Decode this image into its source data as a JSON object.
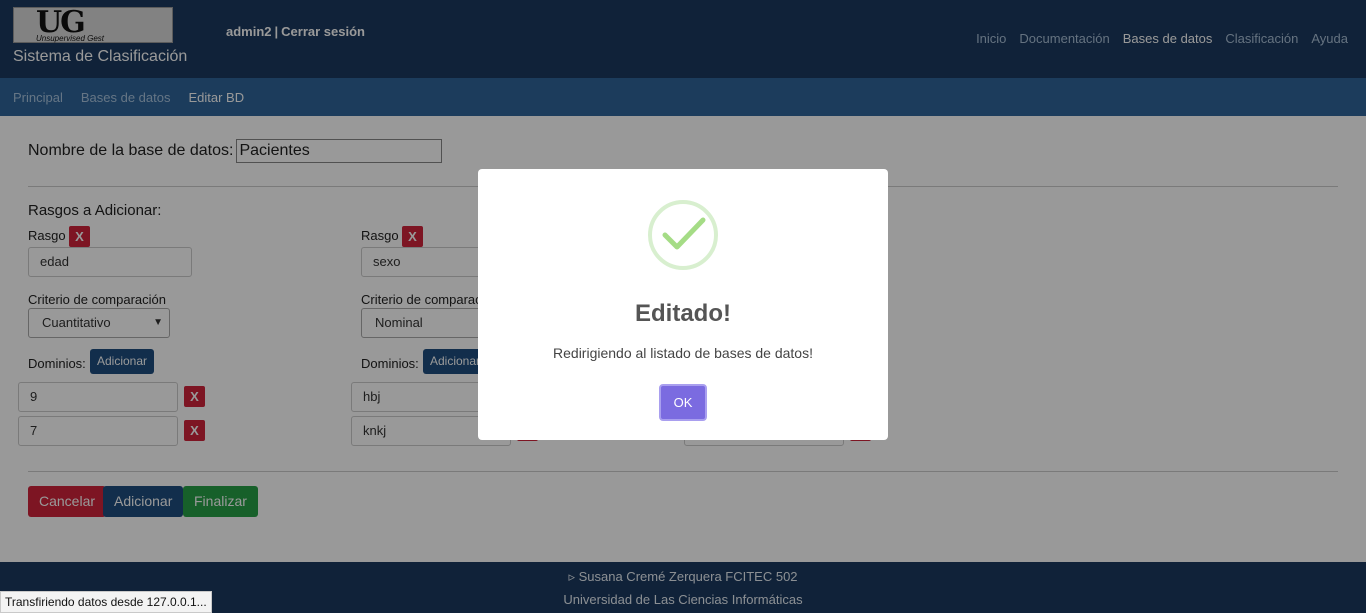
{
  "header": {
    "logo_text": "UG",
    "logo_subtext": "Unsupervised Gest",
    "app_title": "Sistema de Clasificación",
    "user": "admin2",
    "logout": "Cerrar sesión",
    "nav": [
      "Inicio",
      "Documentación",
      "Bases de datos",
      "Clasificación",
      "Ayuda"
    ],
    "nav_active": "Bases de datos"
  },
  "breadcrumb": [
    "Principal",
    "Bases de datos",
    "Editar BD"
  ],
  "form": {
    "db_name_label": "Nombre de la base de datos:",
    "db_name_value": "Pacientes",
    "section_title": "Rasgos a Adicionar:",
    "rasgo_label": "Rasgo",
    "remove_label": "X",
    "criterio_label": "Criterio de comparación",
    "dominios_label": "Dominios:",
    "adicionar_label": "Adicionar",
    "rasgos": [
      {
        "name": "edad",
        "criterio": "Cuantitativo",
        "dominios": [
          "9",
          "7"
        ]
      },
      {
        "name": "sexo",
        "criterio": "Nominal",
        "dominios": [
          "hbj",
          "knkj"
        ]
      }
    ]
  },
  "actions": {
    "cancel": "Cancelar",
    "add": "Adicionar",
    "finish": "Finalizar"
  },
  "footer": {
    "line1": "▹ Susana Cremé Zerquera FCITEC 502",
    "line2": "Universidad de Las Ciencias Informáticas"
  },
  "modal": {
    "title": "Editado!",
    "message": "Redirigiendo al listado de bases de datos!",
    "ok": "OK"
  },
  "status_bar": "Transfiriendo datos desde 127.0.0.1...",
  "colors": {
    "header": "#1b3a5f",
    "subbar": "#2f6599",
    "danger": "#d0243b",
    "primary": "#1f4e7f",
    "success": "#27a046",
    "modal_button": "#7b6be0",
    "success_check": "#a5dc86"
  }
}
